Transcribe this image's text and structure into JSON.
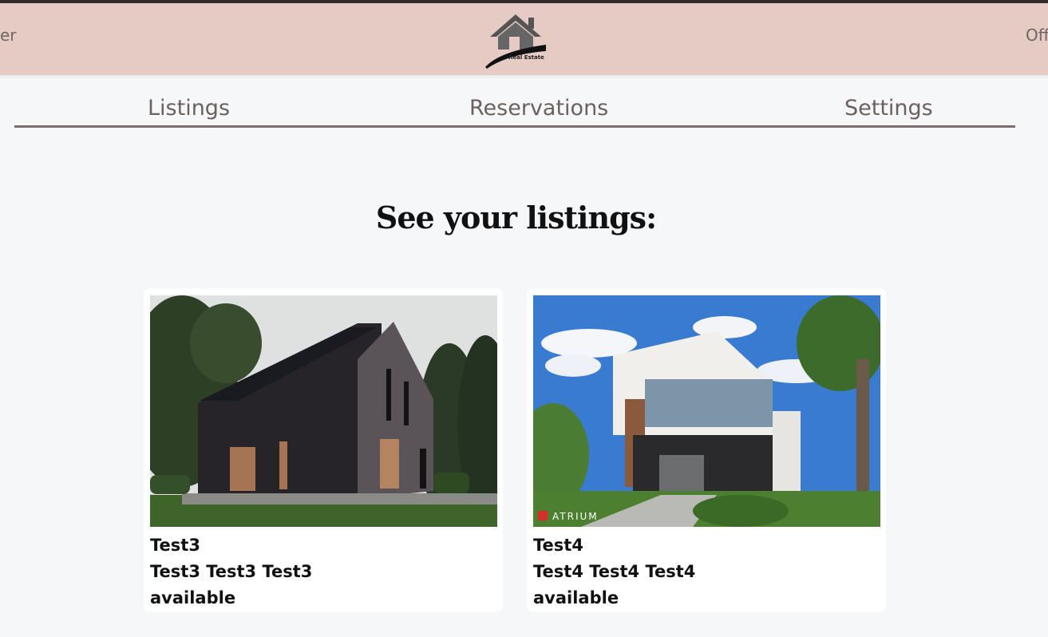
{
  "header": {
    "left_text": "er",
    "right_text": "Off",
    "logo_caption": "Real Estate",
    "logo_icon": "house-icon"
  },
  "nav": {
    "items": [
      {
        "label": "Listings"
      },
      {
        "label": "Reservations"
      },
      {
        "label": "Settings"
      }
    ]
  },
  "main": {
    "title": "See your listings:"
  },
  "listings": [
    {
      "name": "Test3",
      "description": "Test3 Test3 Test3",
      "status": "available",
      "image": "dark-timber-barn-house-photo"
    },
    {
      "name": "Test4",
      "description": "Test4 Test4 Test4",
      "status": "available",
      "image": "modern-white-two-storey-house-photo",
      "watermark": "ATRIUM"
    }
  ],
  "colors": {
    "header_bg": "#e5cbc4",
    "page_bg": "#f6f7f9",
    "nav_text": "#6b615f",
    "nav_underline": "#7a6f6d"
  }
}
